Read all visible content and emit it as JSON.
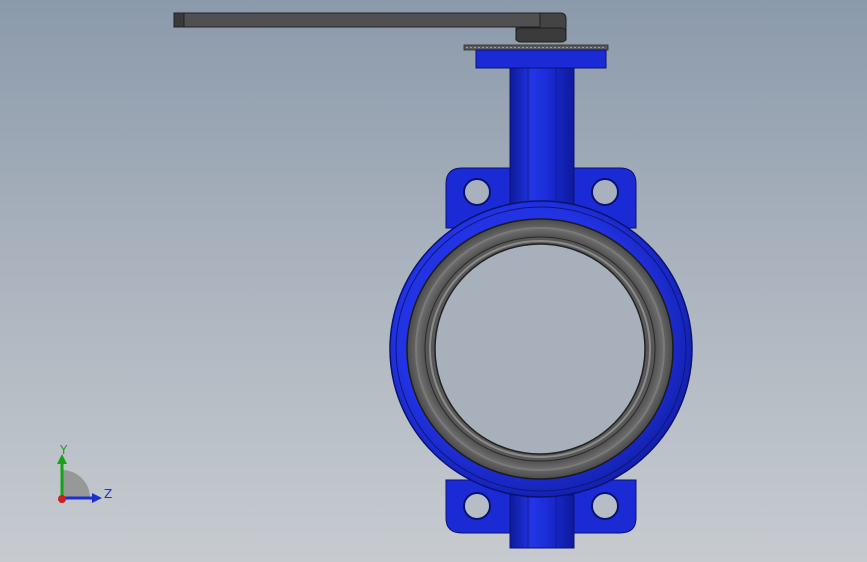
{
  "viewport": {
    "background_top": "#8b9aab",
    "background_bottom": "#c7cbd0"
  },
  "model": {
    "body_color": "#1a2bd6",
    "body_dark": "#0f1a9c",
    "liner_color": "#5a5a5a",
    "handle_color": "#4a4a4a"
  },
  "triad": {
    "y_label": "Y",
    "z_label": "Z",
    "y_color": "#17a317",
    "z_color": "#1c2fd0",
    "x_color": "#d01c1c"
  }
}
